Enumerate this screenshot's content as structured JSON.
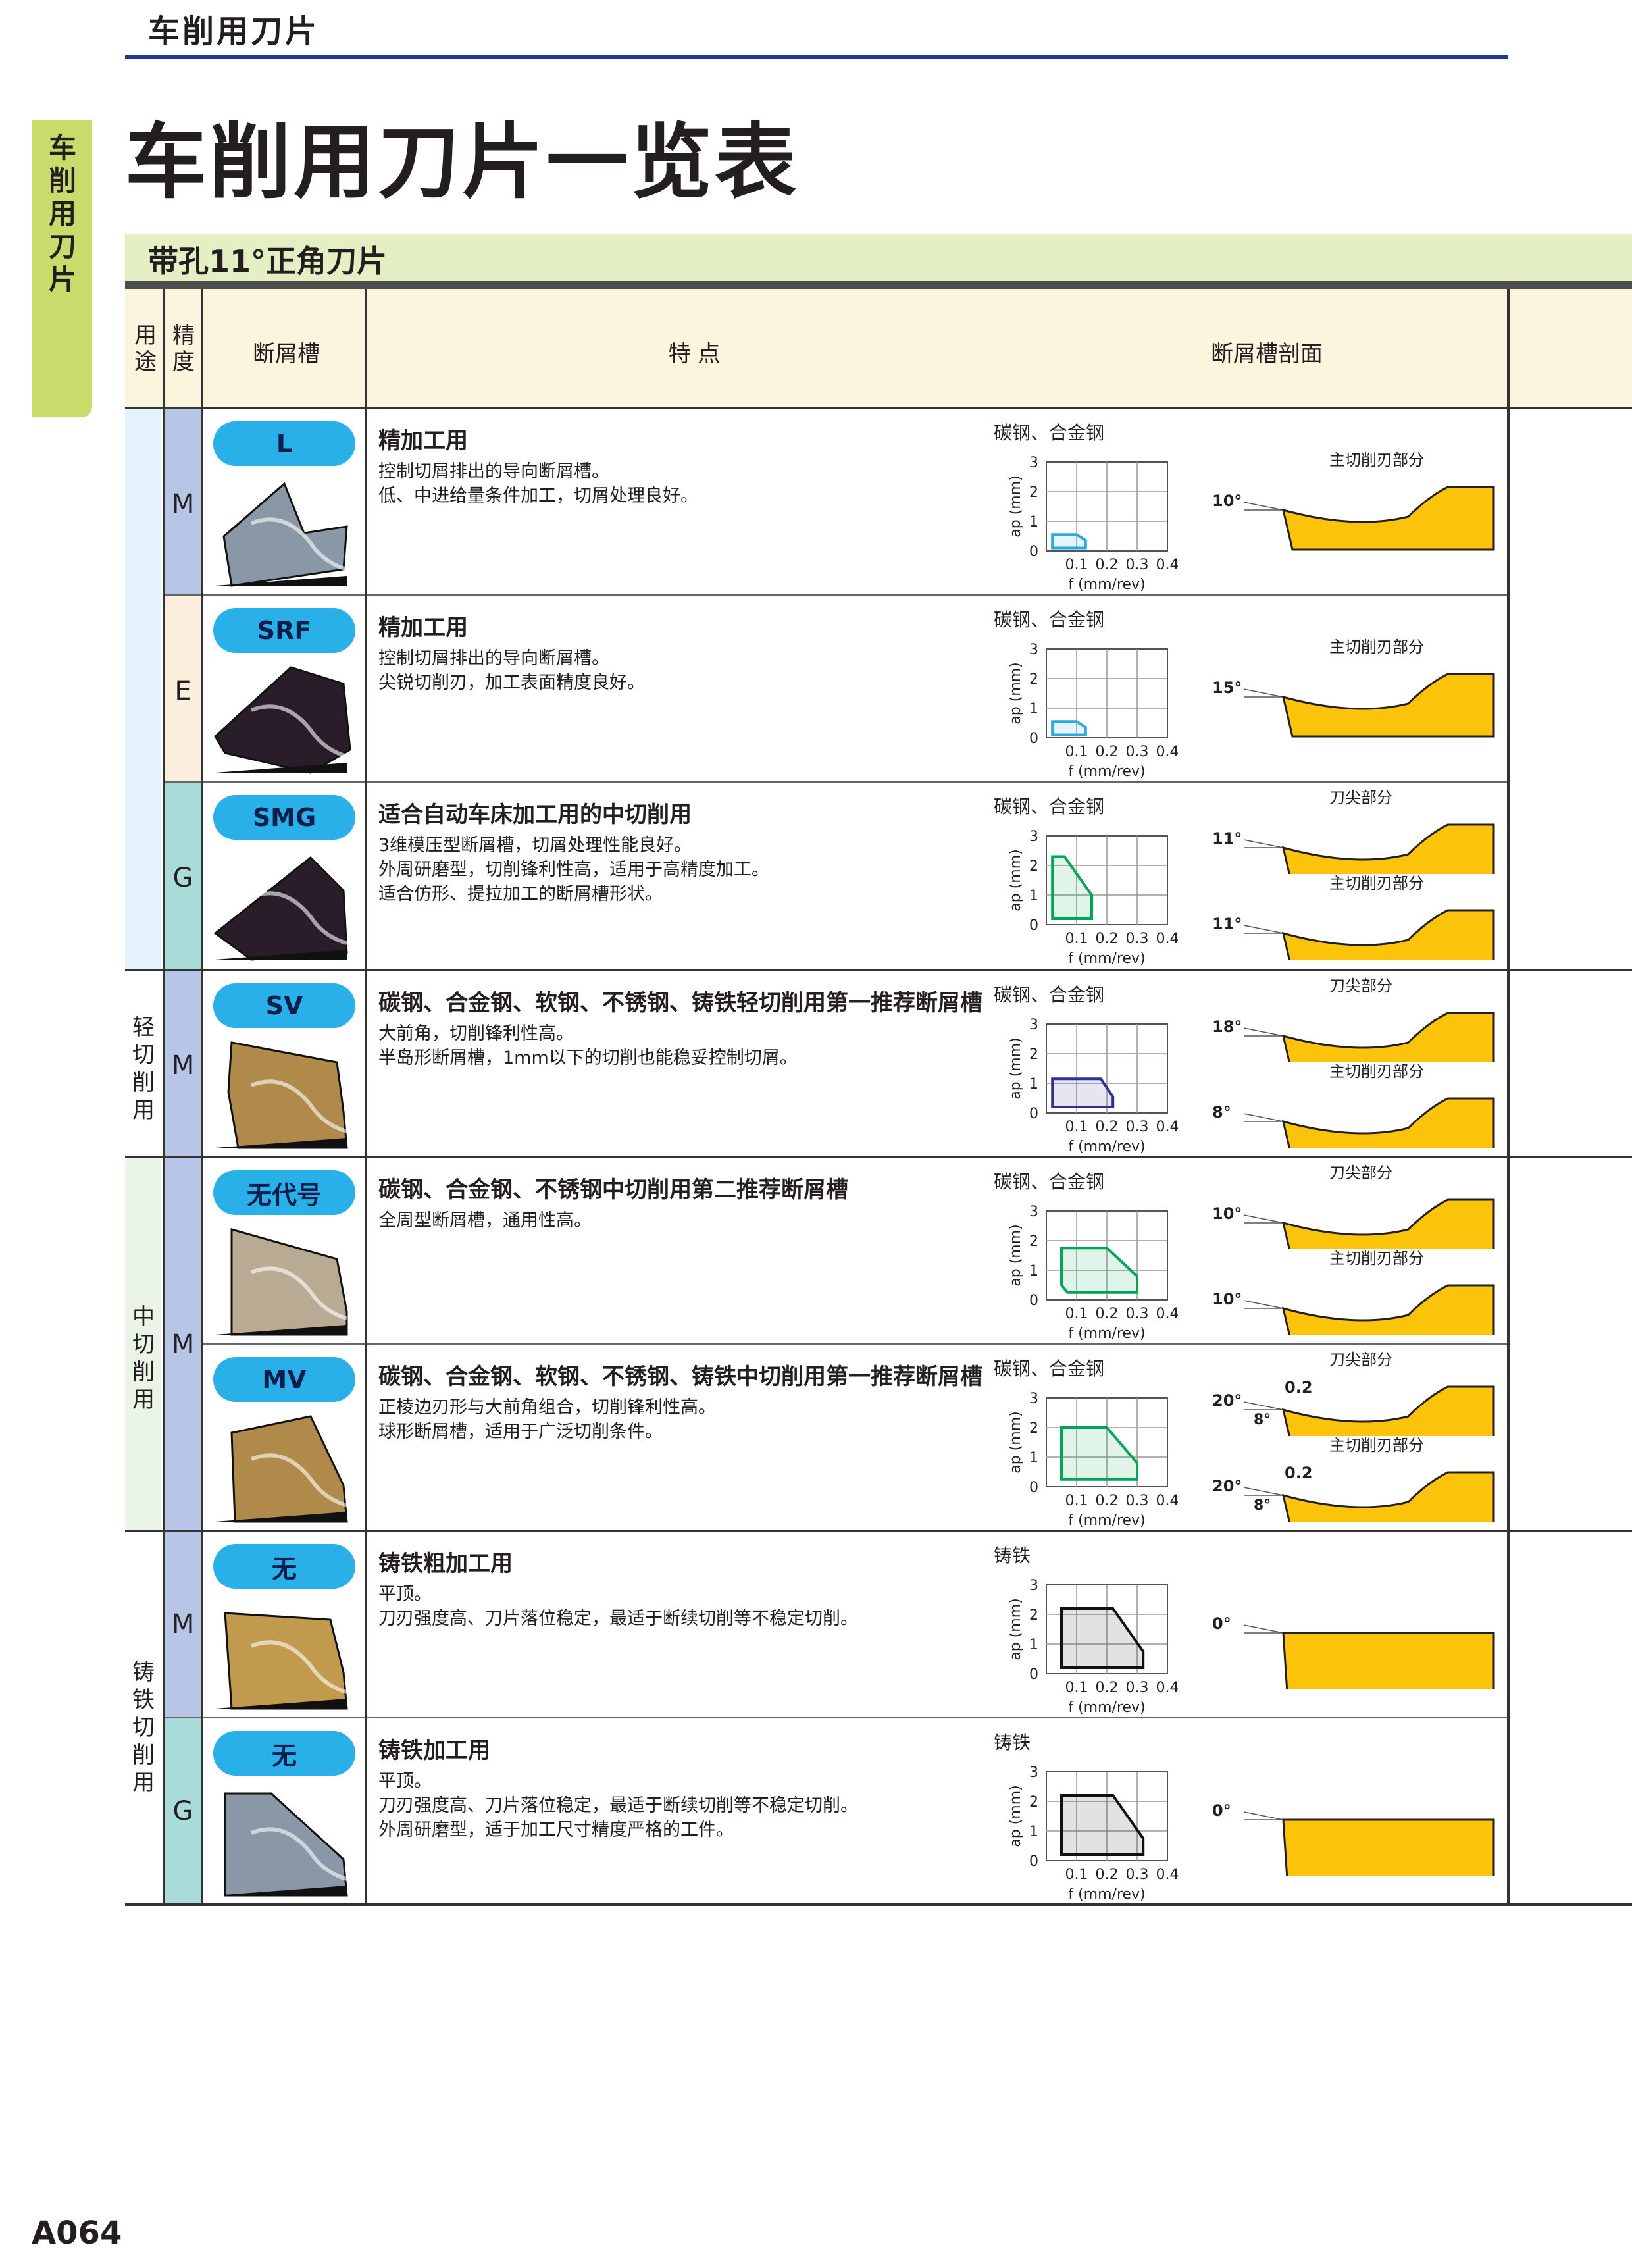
{
  "header": {
    "section": "车削用刀片",
    "title": "车削用刀片一览表",
    "side_tab": "车削用刀片",
    "subtitle": "带孔11°正角刀片"
  },
  "columns": {
    "use": "用途",
    "precision": "精度",
    "groove": "断屑槽",
    "features": "特 点",
    "section": "断屑槽剖面"
  },
  "chart_axes": {
    "ylabel": "ap (mm)",
    "xlabel": "f (mm/rev)",
    "x_ticks": [
      "0.1",
      "0.2",
      "0.3",
      "0.4"
    ],
    "y_ticks": [
      "3",
      "2",
      "1"
    ],
    "origin": "0"
  },
  "categories": [
    {
      "label": ""
    },
    {
      "label": "轻切削用"
    },
    {
      "label": "中切削用"
    },
    {
      "label": "铸铁切削用"
    }
  ],
  "precisions": [
    "M",
    "E",
    "G",
    "M",
    "M",
    "M",
    "G"
  ],
  "rows": [
    {
      "badge": "L",
      "title": "精加工用",
      "lines": [
        "控制切屑排出的导向断屑槽。",
        "低、中进给量条件加工，切屑处理良好。"
      ],
      "material": "碳钢、合金钢",
      "chart": {
        "color": "#29a9e0",
        "points": [
          [
            0.02,
            0.1
          ],
          [
            0.13,
            0.1
          ],
          [
            0.13,
            0.35
          ],
          [
            0.1,
            0.55
          ],
          [
            0.02,
            0.55
          ]
        ]
      },
      "profile": [
        {
          "angle": "10°",
          "label": "主切削刃部分"
        }
      ],
      "insert_color": "#8a97a6"
    },
    {
      "badge": "SRF",
      "title": "精加工用",
      "lines": [
        "控制切屑排出的导向断屑槽。",
        "尖锐切削刃，加工表面精度良好。"
      ],
      "material": "碳钢、合金钢",
      "chart": {
        "color": "#29a9e0",
        "points": [
          [
            0.02,
            0.1
          ],
          [
            0.13,
            0.1
          ],
          [
            0.13,
            0.35
          ],
          [
            0.1,
            0.55
          ],
          [
            0.02,
            0.55
          ]
        ]
      },
      "profile": [
        {
          "angle": "15°",
          "label": "主切削刃部分"
        }
      ],
      "insert_color": "#2a1d2a"
    },
    {
      "badge": "SMG",
      "title": "适合自动车床加工用的中切削用",
      "lines": [
        "3维模压型断屑槽，切屑处理性能良好。",
        "外周研磨型，切削锋利性高，适用于高精度加工。",
        "适合仿形、提拉加工的断屑槽形状。"
      ],
      "material": "碳钢、合金钢",
      "chart": {
        "color": "#00a651",
        "points": [
          [
            0.02,
            0.2
          ],
          [
            0.15,
            0.2
          ],
          [
            0.15,
            1.0
          ],
          [
            0.06,
            2.3
          ],
          [
            0.02,
            2.3
          ]
        ]
      },
      "profile": [
        {
          "angle": "11°",
          "label": "刀尖部分"
        },
        {
          "angle": "11°",
          "label": "主切削刃部分"
        }
      ],
      "insert_color": "#2a1d2a"
    },
    {
      "badge": "SV",
      "title": "碳钢、合金钢、软钢、不锈钢、铸铁轻切削用第一推荐断屑槽",
      "lines": [
        "大前角，切削锋利性高。",
        "半岛形断屑槽，1mm以下的切削也能稳妥控制切屑。"
      ],
      "material": "碳钢、合金钢",
      "chart": {
        "color": "#2e3192",
        "points": [
          [
            0.02,
            0.2
          ],
          [
            0.22,
            0.2
          ],
          [
            0.22,
            0.55
          ],
          [
            0.18,
            1.15
          ],
          [
            0.02,
            1.15
          ]
        ]
      },
      "profile": [
        {
          "angle": "18°",
          "label": "刀尖部分"
        },
        {
          "angle": "8°",
          "label": "主切削刃部分"
        }
      ],
      "insert_color": "#b08a4a"
    },
    {
      "badge": "无代号",
      "title": "碳钢、合金钢、不锈钢中切削用第二推荐断屑槽",
      "lines": [
        "全周型断屑槽，通用性高。"
      ],
      "material": "碳钢、合金钢",
      "chart": {
        "color": "#00a651",
        "points": [
          [
            0.05,
            0.5
          ],
          [
            0.07,
            0.25
          ],
          [
            0.3,
            0.25
          ],
          [
            0.3,
            0.8
          ],
          [
            0.2,
            1.75
          ],
          [
            0.05,
            1.75
          ]
        ]
      },
      "profile": [
        {
          "angle": "10°",
          "label": "刀尖部分"
        },
        {
          "angle": "10°",
          "label": "主切削刃部分"
        }
      ],
      "insert_color": "#b9aa94"
    },
    {
      "badge": "MV",
      "title": "碳钢、合金钢、软钢、不锈钢、铸铁中切削用第一推荐断屑槽",
      "lines": [
        "正棱边刃形与大前角组合，切削锋利性高。",
        "球形断屑槽，适用于广泛切削条件。"
      ],
      "material": "碳钢、合金钢",
      "chart": {
        "color": "#00a651",
        "points": [
          [
            0.05,
            0.25
          ],
          [
            0.3,
            0.25
          ],
          [
            0.3,
            0.8
          ],
          [
            0.2,
            2.0
          ],
          [
            0.05,
            2.0
          ]
        ]
      },
      "profile": [
        {
          "angle": "20°",
          "angle2": "8°",
          "land": "0.2",
          "label": "刀尖部分"
        },
        {
          "angle": "20°",
          "angle2": "8°",
          "land": "0.2",
          "label": "主切削刃部分"
        }
      ],
      "insert_color": "#b08a4a"
    },
    {
      "badge": "无",
      "title": "铸铁粗加工用",
      "lines": [
        "平顶。",
        "刀刃强度高、刀片落位稳定，最适于断续切削等不稳定切削。"
      ],
      "material": "铸铁",
      "chart": {
        "color": "#111111",
        "points": [
          [
            0.05,
            0.2
          ],
          [
            0.32,
            0.2
          ],
          [
            0.32,
            0.75
          ],
          [
            0.22,
            2.2
          ],
          [
            0.05,
            2.2
          ]
        ]
      },
      "profile": [
        {
          "angle": "0°",
          "label": ""
        }
      ],
      "insert_color": "#c19a4e"
    },
    {
      "badge": "无",
      "title": "铸铁加工用",
      "lines": [
        "平顶。",
        "刀刃强度高、刀片落位稳定，最适于断续切削等不稳定切削。",
        "外周研磨型，适于加工尺寸精度严格的工件。"
      ],
      "material": "铸铁",
      "chart": {
        "color": "#111111",
        "points": [
          [
            0.05,
            0.2
          ],
          [
            0.32,
            0.2
          ],
          [
            0.32,
            0.75
          ],
          [
            0.22,
            2.2
          ],
          [
            0.05,
            2.2
          ]
        ]
      },
      "profile": [
        {
          "angle": "0°",
          "label": ""
        }
      ],
      "insert_color": "#8a97a6"
    }
  ],
  "page_number": "A064"
}
